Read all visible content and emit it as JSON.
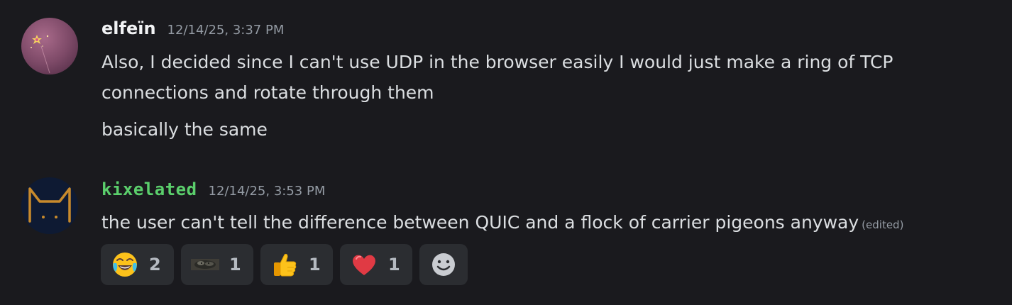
{
  "messages": [
    {
      "author": "elfeïn",
      "timestamp": "12/14/25, 3:37 PM",
      "lines": [
        "Also, I decided since I can't use UDP in the browser easily I would just make a ring of TCP",
        "connections and rotate through them",
        "basically the same"
      ]
    },
    {
      "author": "kixelated",
      "author_color": "#5bcf6c",
      "timestamp": "12/14/25, 3:53 PM",
      "lines": [
        "the user can't tell the difference between QUIC and a flock of carrier pigeons anyway"
      ],
      "edited_label": "(edited)",
      "reactions": [
        {
          "emoji": "joy-face-emoji",
          "count": "2"
        },
        {
          "emoji": "custom-animal-emoji",
          "count": "1"
        },
        {
          "emoji": "thumbs-up-emoji",
          "count": "1"
        },
        {
          "emoji": "red-heart-emoji",
          "count": "1"
        }
      ],
      "add_reaction_icon": "smiley-icon"
    }
  ]
}
